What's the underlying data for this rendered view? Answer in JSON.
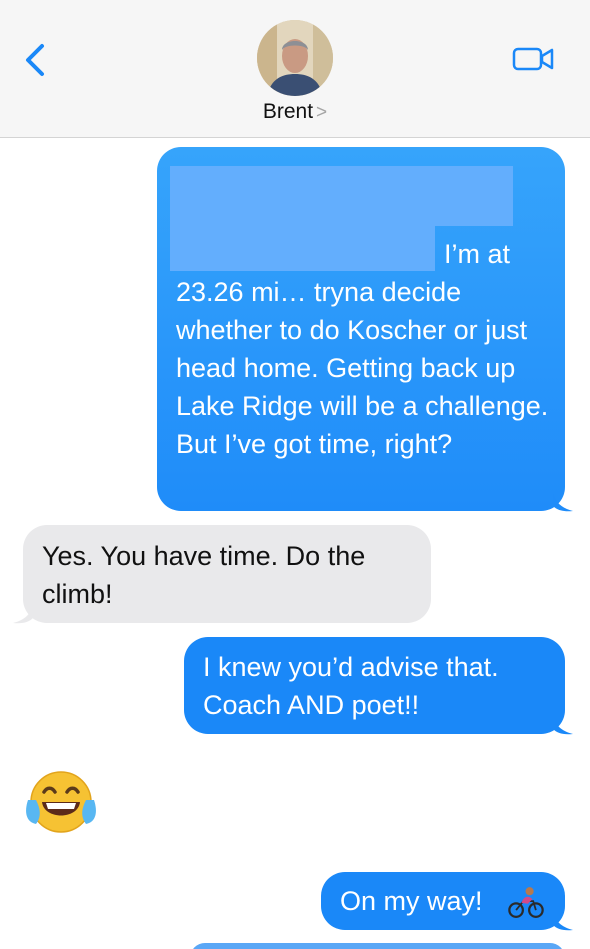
{
  "header": {
    "contact_name": "Brent",
    "chevron": ">",
    "back_icon": "chevron-left-icon",
    "video_icon": "video-camera-icon",
    "accent_color": "#1a88f8"
  },
  "messages": [
    {
      "direction": "outgoing",
      "text_line1": "I’m at",
      "text_rest": "23.26 mi… tryna decide whether to do Koscher or just head home. Getting back up Lake Ridge will be a challenge. But I’ve got time, right?"
    },
    {
      "direction": "incoming",
      "text": "Yes. You have time. Do the climb!"
    },
    {
      "direction": "outgoing",
      "text": "I knew you’d advise that. Coach AND poet!!"
    },
    {
      "direction": "incoming",
      "emoji": "face-with-tears-of-joy"
    },
    {
      "direction": "outgoing",
      "text": "On my way!",
      "emoji": "person-biking"
    }
  ]
}
